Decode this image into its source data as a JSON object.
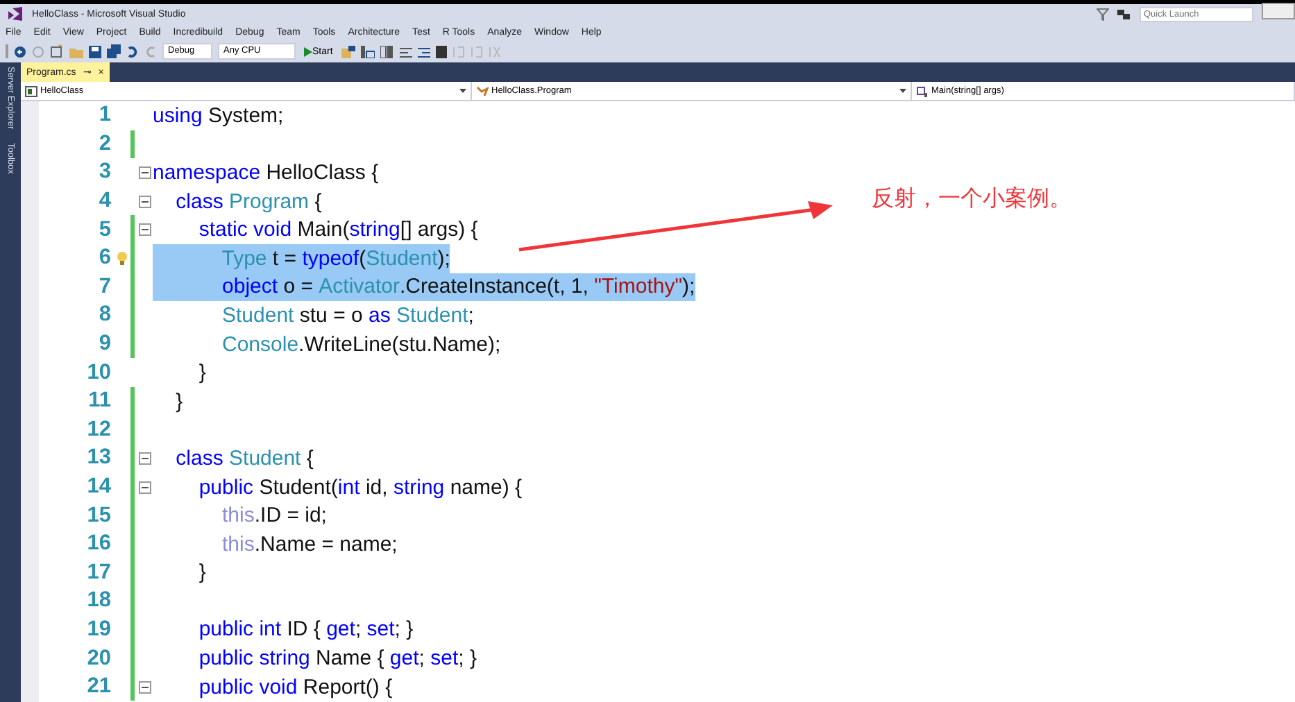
{
  "window": {
    "title": "HelloClass - Microsoft Visual Studio",
    "quick_launch": {
      "placeholder": "Quick Launch"
    }
  },
  "menu": [
    "File",
    "Edit",
    "View",
    "Project",
    "Build",
    "Incredibuild",
    "Debug",
    "Team",
    "Tools",
    "Architecture",
    "Test",
    "R Tools",
    "Analyze",
    "Window",
    "Help"
  ],
  "toolbar": {
    "configuration": "Debug",
    "platform": "Any CPU",
    "start": "Start"
  },
  "side_tabs": [
    "Server Explorer",
    "Toolbox"
  ],
  "tabs": [
    {
      "label": "Program.cs",
      "selected": true,
      "pin": "⊸",
      "close": "×"
    }
  ],
  "navigation": [
    "HelloClass",
    "HelloClass.Program",
    "Main(string[] args)"
  ],
  "editor": {
    "lines": [
      {
        "number": "1",
        "changed": false,
        "fold": false,
        "selected": false,
        "lightbulb": false,
        "tokens": [
          {
            "kind": "keyword",
            "text": "using "
          },
          {
            "kind": "plain",
            "text": "System;"
          }
        ]
      },
      {
        "number": "2",
        "changed": true,
        "fold": false,
        "selected": false,
        "lightbulb": false
      },
      {
        "number": "3",
        "changed": false,
        "fold": true,
        "selected": false,
        "lightbulb": false,
        "tokens": [
          {
            "kind": "keyword",
            "text": "namespace "
          },
          {
            "kind": "plain",
            "text": "HelloClass {"
          }
        ]
      },
      {
        "number": "4",
        "changed": false,
        "fold": true,
        "selected": false,
        "lightbulb": false,
        "tokens": [
          {
            "kind": "keyword",
            "text": "    class "
          },
          {
            "kind": "type",
            "text": "Program"
          },
          {
            "kind": "plain",
            "text": " {"
          }
        ]
      },
      {
        "number": "5",
        "changed": true,
        "fold": true,
        "selected": false,
        "lightbulb": false,
        "tokens": [
          {
            "kind": "keyword",
            "text": "        static void "
          },
          {
            "kind": "plain",
            "text": "Main("
          },
          {
            "kind": "keyword",
            "text": "string"
          },
          {
            "kind": "plain",
            "text": "[] args) {"
          }
        ]
      },
      {
        "number": "6",
        "changed": true,
        "fold": false,
        "selected": true,
        "lightbulb": true,
        "tokens": [
          {
            "kind": "type",
            "text": "            Type"
          },
          {
            "kind": "plain",
            "text": " t = "
          },
          {
            "kind": "keyword",
            "text": "typeof"
          },
          {
            "kind": "plain",
            "text": "("
          },
          {
            "kind": "type",
            "text": "Student"
          },
          {
            "kind": "plain",
            "text": ");"
          }
        ]
      },
      {
        "number": "7",
        "changed": true,
        "fold": false,
        "selected": true,
        "lightbulb": false,
        "tokens": [
          {
            "kind": "keyword",
            "text": "            object"
          },
          {
            "kind": "plain",
            "text": " o = "
          },
          {
            "kind": "type",
            "text": "Activator"
          },
          {
            "kind": "plain",
            "text": ".CreateInstance(t, 1, "
          },
          {
            "kind": "string",
            "text": "\"Timothy\""
          },
          {
            "kind": "plain",
            "text": ");"
          }
        ]
      },
      {
        "number": "8",
        "changed": true,
        "fold": false,
        "selected": false,
        "lightbulb": false,
        "tokens": [
          {
            "kind": "type",
            "text": "            Student"
          },
          {
            "kind": "plain",
            "text": " stu = o "
          },
          {
            "kind": "keyword",
            "text": "as "
          },
          {
            "kind": "type",
            "text": "Student"
          },
          {
            "kind": "plain",
            "text": ";"
          }
        ]
      },
      {
        "number": "9",
        "changed": true,
        "fold": false,
        "selected": false,
        "lightbulb": false,
        "tokens": [
          {
            "kind": "type",
            "text": "            Console"
          },
          {
            "kind": "plain",
            "text": ".WriteLine(stu.Name);"
          }
        ]
      },
      {
        "number": "10",
        "changed": false,
        "fold": false,
        "selected": false,
        "lightbulb": false,
        "tokens": [
          {
            "kind": "plain",
            "text": "        }"
          }
        ]
      },
      {
        "number": "11",
        "changed": true,
        "fold": false,
        "selected": false,
        "lightbulb": false,
        "tokens": [
          {
            "kind": "plain",
            "text": "    }"
          }
        ]
      },
      {
        "number": "12",
        "changed": true,
        "fold": false,
        "selected": false,
        "lightbulb": false
      },
      {
        "number": "13",
        "changed": true,
        "fold": true,
        "selected": false,
        "lightbulb": false,
        "tokens": [
          {
            "kind": "keyword",
            "text": "    class "
          },
          {
            "kind": "type",
            "text": "Student"
          },
          {
            "kind": "plain",
            "text": " {"
          }
        ]
      },
      {
        "number": "14",
        "changed": true,
        "fold": true,
        "selected": false,
        "lightbulb": false,
        "tokens": [
          {
            "kind": "keyword",
            "text": "        public "
          },
          {
            "kind": "plain",
            "text": "Student("
          },
          {
            "kind": "keyword",
            "text": "int "
          },
          {
            "kind": "plain",
            "text": "id, "
          },
          {
            "kind": "keyword",
            "text": "string "
          },
          {
            "kind": "plain",
            "text": "name) {"
          }
        ]
      },
      {
        "number": "15",
        "changed": true,
        "fold": false,
        "selected": false,
        "lightbulb": false,
        "tokens": [
          {
            "kind": "this",
            "text": "            this"
          },
          {
            "kind": "plain",
            "text": ".ID = id;"
          }
        ]
      },
      {
        "number": "16",
        "changed": true,
        "fold": false,
        "selected": false,
        "lightbulb": false,
        "tokens": [
          {
            "kind": "this",
            "text": "            this"
          },
          {
            "kind": "plain",
            "text": ".Name = name;"
          }
        ]
      },
      {
        "number": "17",
        "changed": true,
        "fold": false,
        "selected": false,
        "lightbulb": false,
        "tokens": [
          {
            "kind": "plain",
            "text": "        }"
          }
        ]
      },
      {
        "number": "18",
        "changed": true,
        "fold": false,
        "selected": false,
        "lightbulb": false
      },
      {
        "number": "19",
        "changed": true,
        "fold": false,
        "selected": false,
        "lightbulb": false,
        "tokens": [
          {
            "kind": "keyword",
            "text": "        public int "
          },
          {
            "kind": "plain",
            "text": "ID { "
          },
          {
            "kind": "keyword",
            "text": "get"
          },
          {
            "kind": "plain",
            "text": "; "
          },
          {
            "kind": "keyword",
            "text": "set"
          },
          {
            "kind": "plain",
            "text": "; }"
          }
        ]
      },
      {
        "number": "20",
        "changed": true,
        "fold": false,
        "selected": false,
        "lightbulb": false,
        "tokens": [
          {
            "kind": "keyword",
            "text": "        public string "
          },
          {
            "kind": "plain",
            "text": "Name { "
          },
          {
            "kind": "keyword",
            "text": "get"
          },
          {
            "kind": "plain",
            "text": "; "
          },
          {
            "kind": "keyword",
            "text": "set"
          },
          {
            "kind": "plain",
            "text": "; }"
          }
        ]
      },
      {
        "number": "21",
        "changed": true,
        "fold": true,
        "selected": false,
        "lightbulb": false,
        "tokens": [
          {
            "kind": "keyword",
            "text": "        public void "
          },
          {
            "kind": "plain",
            "text": "Report() {"
          }
        ]
      }
    ]
  },
  "annotation": {
    "text": "反射，一个小案例。"
  }
}
